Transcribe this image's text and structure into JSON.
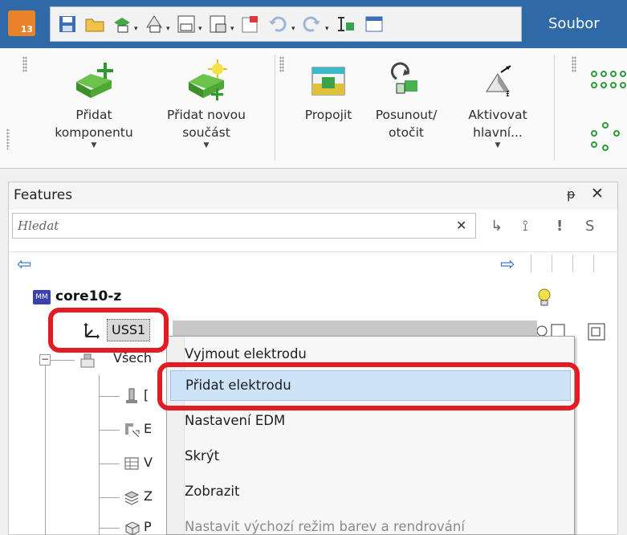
{
  "app": {
    "version_badge": "13",
    "title_tab": "Soubor"
  },
  "qat": {
    "buttons": [
      "save-icon",
      "open-icon",
      "assembly-icon",
      "part-icon",
      "drawing-icon",
      "sheet-icon",
      "import-icon",
      "undo-icon",
      "redo-icon",
      "rebuild-icon",
      "window-icon"
    ]
  },
  "ribbon": {
    "buttons": [
      {
        "line1": "Přidat",
        "line2": "komponentu",
        "has_dropdown": true
      },
      {
        "line1": "Přidat novou",
        "line2": "součást",
        "has_dropdown": true
      },
      {
        "line1": "Propojit",
        "line2": "",
        "has_dropdown": false
      },
      {
        "line1": "Posunout/",
        "line2": "otočit",
        "has_dropdown": false
      },
      {
        "line1": "Aktivovat",
        "line2": "hlavní...",
        "has_dropdown": true
      }
    ]
  },
  "panel": {
    "title": "Features",
    "pin_glyph": "ᵽ",
    "close_glyph": "✕",
    "search": {
      "placeholder": "Hledat",
      "value": ""
    },
    "clear_glyph": "✕",
    "filter_glyphs": [
      "↳",
      "⟟",
      "!",
      "S"
    ],
    "nav": {
      "back": "⇦",
      "forward": "⇨"
    },
    "tree": {
      "root": {
        "label": "core10-z",
        "icon_text": "MM"
      },
      "uss": {
        "label": "USS1"
      },
      "group": {
        "label": "Všech"
      },
      "children": [
        {
          "letter": "[",
          "icon": "electrode-icon"
        },
        {
          "letter": "E",
          "icon": "edm-icon"
        },
        {
          "letter": "V",
          "icon": "volume-icon"
        },
        {
          "letter": "Z",
          "icon": "layer-icon"
        },
        {
          "letter": "P",
          "icon": "part-icon"
        }
      ]
    }
  },
  "context_menu": {
    "items": [
      {
        "label": "Vyjmout elektrodu",
        "selected": false,
        "disabled": false
      },
      {
        "label": "Přidat elektrodu",
        "selected": true,
        "disabled": false
      },
      {
        "label": "Nastavení EDM",
        "selected": false,
        "disabled": false
      },
      {
        "label": "Skrýt",
        "selected": false,
        "disabled": false
      },
      {
        "label": "Zobrazit",
        "selected": false,
        "disabled": false
      },
      {
        "label": "Nastavit výchozí režim barev a rendrování",
        "selected": false,
        "disabled": true
      }
    ]
  },
  "colors": {
    "accent": "#2f6aa7",
    "annotation": "#e31b23",
    "selection": "#cde3f7"
  }
}
